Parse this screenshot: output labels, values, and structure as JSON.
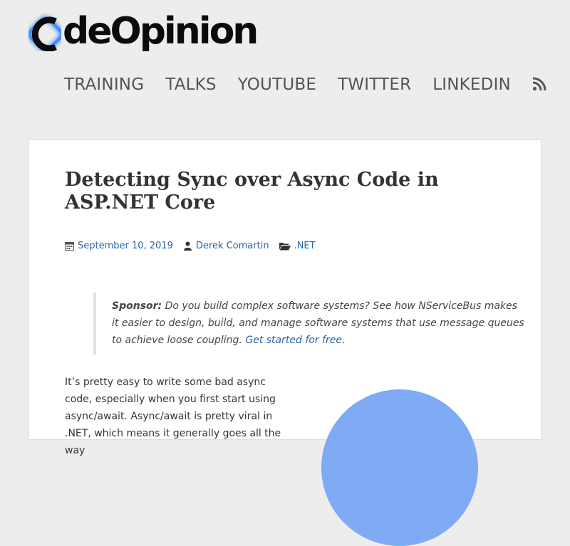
{
  "logo": {
    "text": "deOpinion",
    "alt": "CodeOpinion"
  },
  "nav": {
    "items": [
      "TRAINING",
      "TALKS",
      "YOUTUBE",
      "TWITTER",
      "LINKEDIN"
    ],
    "rss_icon": "rss-icon"
  },
  "post": {
    "title": "Detecting Sync over Async Code in ASP.NET Core",
    "date": "September 10, 2019",
    "author": "Derek Comartin",
    "category": ".NET",
    "sponsor": {
      "label": "Sponsor:",
      "text": " Do you build complex software systems? See how NServiceBus makes it easier to design, build, and manage software systems that use message queues to achieve loose coupling. ",
      "link": "Get started for free",
      "end": "."
    },
    "body": "It’s pretty easy to write some bad async code, especially when you first start using async/await. Async/await is pretty viral in .NET, which means it generally goes all the way"
  },
  "colors": {
    "link": "#2a63a8",
    "logo_accent": "#1a6fe0",
    "circle": "#7fabf5"
  }
}
